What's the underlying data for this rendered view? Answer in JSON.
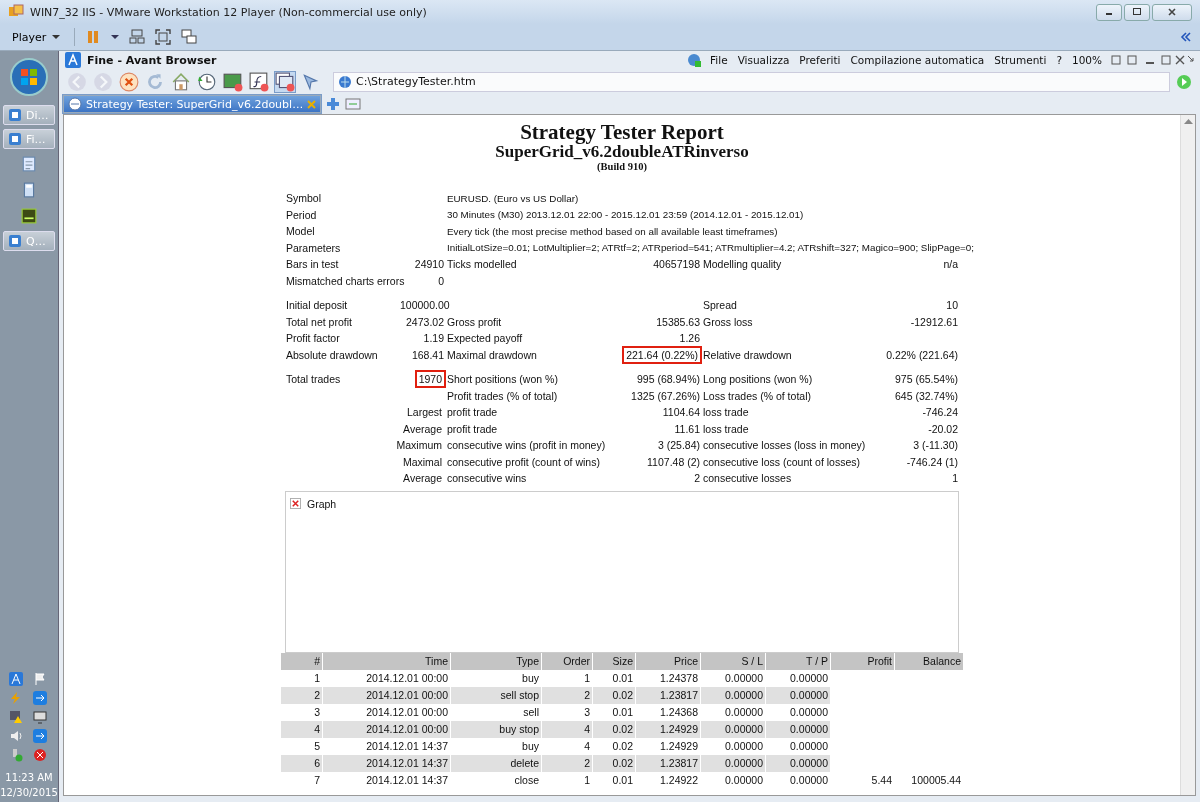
{
  "window": {
    "title": "WIN7_32 IIS - VMware Workstation 12 Player (Non-commercial use only)"
  },
  "player_toolbar": {
    "menu": "Player"
  },
  "taskbar": {
    "buttons": [
      {
        "label": "Di…",
        "kind": "window"
      },
      {
        "label": "Fi…",
        "kind": "window"
      },
      {
        "kind": "notepad"
      },
      {
        "kind": "calculator"
      },
      {
        "kind": "dw"
      },
      {
        "label": "Q…",
        "kind": "window"
      }
    ],
    "clock": {
      "time": "11:23 AM",
      "date": "12/30/2015"
    }
  },
  "browser": {
    "title": "Fine - Avant Browser",
    "menu": [
      "File",
      "Visualizza",
      "Preferiti",
      "Compilazione automatica",
      "Strumenti",
      "?",
      "100%"
    ],
    "address": "C:\\StrategyTester.htm",
    "tabs": [
      {
        "label": "Strategy Tester: SuperGrid_v6.2doubl…",
        "selected": true
      }
    ]
  },
  "report": {
    "title": "Strategy Tester Report",
    "expert": "SuperGrid_v6.2doubleATRinverso",
    "build": "(Build 910)",
    "groups": [
      [
        {
          "kind": "info",
          "label": "Symbol",
          "text": "EURUSD. (Euro vs US Dollar)"
        },
        {
          "kind": "info",
          "label": "Period",
          "text": "30 Minutes (M30) 2013.12.01 22:00 - 2015.12.01 23:59 (2014.12.01 - 2015.12.01)"
        },
        {
          "kind": "info",
          "label": "Model",
          "text": "Every tick (the most precise method based on all available least timeframes)"
        },
        {
          "kind": "info",
          "label": "Parameters",
          "text": "InitialLotSize=0.01; LotMultiplier=2; ATRtf=2; ATRperiod=541; ATRmultiplier=4.2; ATRshift=327; Magico=900; SlipPage=0;"
        },
        {
          "kind": "stats",
          "label": "Bars in test",
          "value": "24910",
          "label2": "Ticks modelled",
          "value2": "40657198",
          "label3": "Modelling quality",
          "value3": "n/a"
        },
        {
          "kind": "stats",
          "label": "Mismatched charts errors",
          "value": "0"
        }
      ],
      [
        {
          "kind": "stats",
          "label": "Initial deposit",
          "value": "100000.00",
          "label3": "Spread",
          "value3": "10"
        },
        {
          "kind": "stats",
          "label": "Total net profit",
          "value": "2473.02",
          "label2": "Gross profit",
          "value2": "15385.63",
          "label3": "Gross loss",
          "value3": "-12912.61"
        },
        {
          "kind": "stats",
          "label": "Profit factor",
          "value": "1.19",
          "label2": "Expected payoff",
          "value2": "1.26"
        },
        {
          "kind": "stats",
          "label": "Absolute drawdown",
          "value": "168.41",
          "label2": "Maximal drawdown",
          "value2": "221.64 (0.22%)",
          "label3": "Relative drawdown",
          "value3": "0.22% (221.64)",
          "value2_boxed": true
        }
      ],
      [
        {
          "kind": "stats",
          "label": "Total trades",
          "value": "1970",
          "label2": "Short positions (won %)",
          "value2": "995 (68.94%)",
          "label3": "Long positions (won %)",
          "value3": "975 (65.54%)",
          "value_boxed": true
        },
        {
          "kind": "stats",
          "label2": "Profit trades (% of total)",
          "value2": "1325 (67.26%)",
          "label3": "Loss trades (% of total)",
          "value3": "645 (32.74%)"
        },
        {
          "kind": "sub",
          "label": "Largest",
          "label2": "profit trade",
          "value2": "1104.64",
          "label3": "loss trade",
          "value3": "-746.24"
        },
        {
          "kind": "sub",
          "label": "Average",
          "label2": "profit trade",
          "value2": "11.61",
          "label3": "loss trade",
          "value3": "-20.02"
        },
        {
          "kind": "sub",
          "label": "Maximum",
          "label2": "consecutive wins (profit in money)",
          "value2": "3 (25.84)",
          "label3": "consecutive losses (loss in money)",
          "value3": "3 (-11.30)"
        },
        {
          "kind": "sub",
          "label": "Maximal",
          "label2": "consecutive profit (count of wins)",
          "value2": "1107.48 (2)",
          "label3": "consecutive loss (count of losses)",
          "value3": "-746.24 (1)"
        },
        {
          "kind": "sub",
          "label": "Average",
          "label2": "consecutive wins",
          "value2": "2",
          "label3": "consecutive losses",
          "value3": "1"
        }
      ]
    ],
    "graph": {
      "alt": "Graph"
    },
    "trades": {
      "columns": [
        "#",
        "Time",
        "Type",
        "Order",
        "Size",
        "Price",
        "S / L",
        "T / P",
        "Profit",
        "Balance"
      ],
      "rows": [
        [
          "1",
          "2014.12.01 00:00",
          "buy",
          "1",
          "0.01",
          "1.24378",
          "0.00000",
          "0.00000"
        ],
        [
          "2",
          "2014.12.01 00:00",
          "sell stop",
          "2",
          "0.02",
          "1.23817",
          "0.00000",
          "0.00000"
        ],
        [
          "3",
          "2014.12.01 00:00",
          "sell",
          "3",
          "0.01",
          "1.24368",
          "0.00000",
          "0.00000"
        ],
        [
          "4",
          "2014.12.01 00:00",
          "buy stop",
          "4",
          "0.02",
          "1.24929",
          "0.00000",
          "0.00000"
        ],
        [
          "5",
          "2014.12.01 14:37",
          "buy",
          "4",
          "0.02",
          "1.24929",
          "0.00000",
          "0.00000"
        ],
        [
          "6",
          "2014.12.01 14:37",
          "delete",
          "2",
          "0.02",
          "1.23817",
          "0.00000",
          "0.00000"
        ],
        [
          "7",
          "2014.12.01 14:37",
          "close",
          "1",
          "0.01",
          "1.24922",
          "0.00000",
          "0.00000",
          "5.44",
          "100005.44"
        ]
      ]
    }
  }
}
